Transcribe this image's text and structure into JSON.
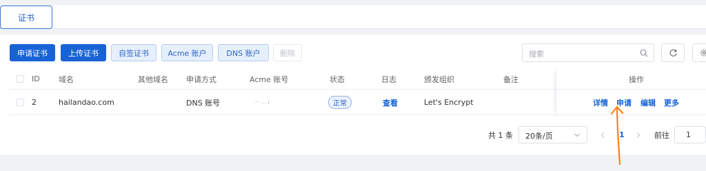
{
  "tabs": [
    {
      "label": "证书"
    }
  ],
  "toolbar": {
    "apply_cert": "申请证书",
    "upload_cert": "上传证书",
    "self_signed": "自签证书",
    "acme_account": "Acme 账户",
    "dns_account": "DNS 账户",
    "delete": "删除",
    "search_placeholder": "搜索"
  },
  "table": {
    "headers": {
      "id": "ID",
      "domain": "域名",
      "other_domains": "其他域名",
      "apply_method": "申请方式",
      "acme_account": "Acme 账号",
      "status": "状态",
      "log": "日志",
      "issuer": "颁发组织",
      "remark": "备注",
      "actions": "操作"
    },
    "rows": [
      {
        "id": "2",
        "domain": "hailandao.com",
        "other_domains": "",
        "apply_method": "DNS 账号",
        "acme_account": "···    ·..    ı",
        "status": "正常",
        "log": "查看",
        "issuer": "Let's Encrypt",
        "remark": "",
        "actions": {
          "detail": "详情",
          "apply": "申请",
          "edit": "编辑",
          "more": "更多"
        }
      }
    ]
  },
  "pagination": {
    "total": "共 1 条",
    "page_size": "20条/页",
    "current_page": "1",
    "goto_label": "前往",
    "goto_value": "1"
  },
  "colors": {
    "primary": "#1763d6",
    "annotation_arrow": "#f5821f"
  },
  "icons": [
    "search-icon",
    "refresh-icon",
    "settings-icon",
    "chevron-down-icon",
    "chevron-left-icon",
    "chevron-right-icon"
  ]
}
